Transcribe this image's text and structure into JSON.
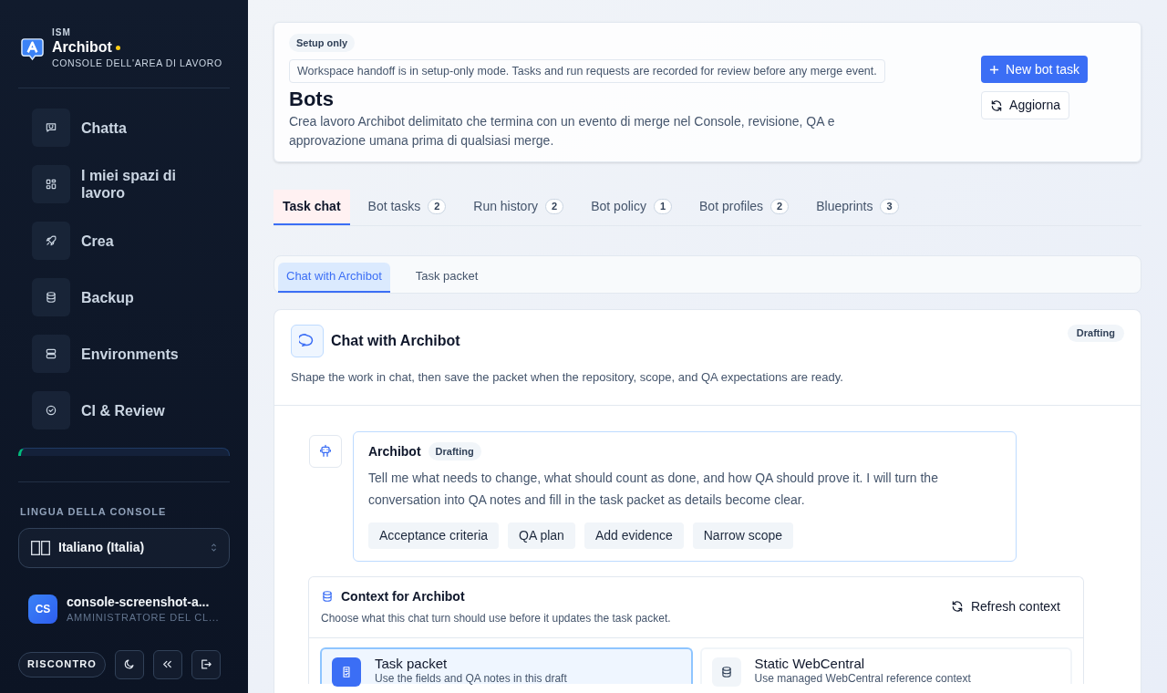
{
  "sidebar": {
    "brand": {
      "eyebrow": "ISM",
      "name": "Archibot",
      "subtitle": "CONSOLE DELL'AREA DI LAVORO"
    },
    "nav": [
      {
        "label": "Chatta"
      },
      {
        "label": "I miei spazi di lavoro"
      },
      {
        "label": "Crea"
      },
      {
        "label": "Backup"
      },
      {
        "label": "Environments"
      },
      {
        "label": "CI & Review"
      }
    ],
    "language": {
      "heading": "LINGUA DELLA CONSOLE",
      "value": "Italiano (Italia)"
    },
    "user": {
      "initials": "CS",
      "name": "console-screenshot-a...",
      "role": "AMMINISTRATORE DEL CL..."
    },
    "feedback_button": "RISCONTRO"
  },
  "header": {
    "badge": "Setup only",
    "notice": "Workspace handoff is in setup-only mode. Tasks and run requests are recorded for review before any merge event.",
    "title": "Bots",
    "description": "Crea lavoro Archibot delimitato che termina con un evento di merge nel Console, revisione, QA e approvazione umana prima di qualsiasi merge.",
    "buttons": [
      {
        "label": "New bot task",
        "kind": "primary"
      },
      {
        "label": "Aggiorna",
        "kind": "secondary"
      }
    ]
  },
  "tabs": [
    {
      "label": "Task chat",
      "selected": true
    },
    {
      "label": "Bot tasks",
      "count": "2",
      "selected": false
    },
    {
      "label": "Run history",
      "count": "2",
      "selected": false
    },
    {
      "label": "Bot policy",
      "count": "1",
      "selected": false
    },
    {
      "label": "Bot profiles",
      "count": "2",
      "selected": false
    },
    {
      "label": "Blueprints",
      "count": "3",
      "selected": false
    }
  ],
  "subtabs": [
    {
      "label": "Chat with Archibot",
      "selected": true
    },
    {
      "label": "Task packet",
      "selected": false
    }
  ],
  "chat_panel": {
    "title": "Chat with Archibot",
    "status": "Drafting",
    "description": "Shape the work in chat, then save the packet when the repository, scope, and QA expectations are ready.",
    "message": {
      "author": "Archibot",
      "status": "Drafting",
      "text": "Tell me what needs to change, what should count as done, and how QA should prove it. I will turn the conversation into QA notes and fill in the task packet as details become clear.",
      "suggestions": [
        "Acceptance criteria",
        "QA plan",
        "Add evidence",
        "Narrow scope"
      ]
    },
    "context": {
      "title": "Context for Archibot",
      "description": "Choose what this chat turn should use before it updates the task packet.",
      "refresh_button": "Refresh context",
      "sources": [
        {
          "title": "Task packet",
          "description": "Use the fields and QA notes in this draft",
          "selected": true
        },
        {
          "title": "Static WebCentral",
          "description": "Use managed WebCentral reference context",
          "selected": false
        }
      ]
    }
  }
}
